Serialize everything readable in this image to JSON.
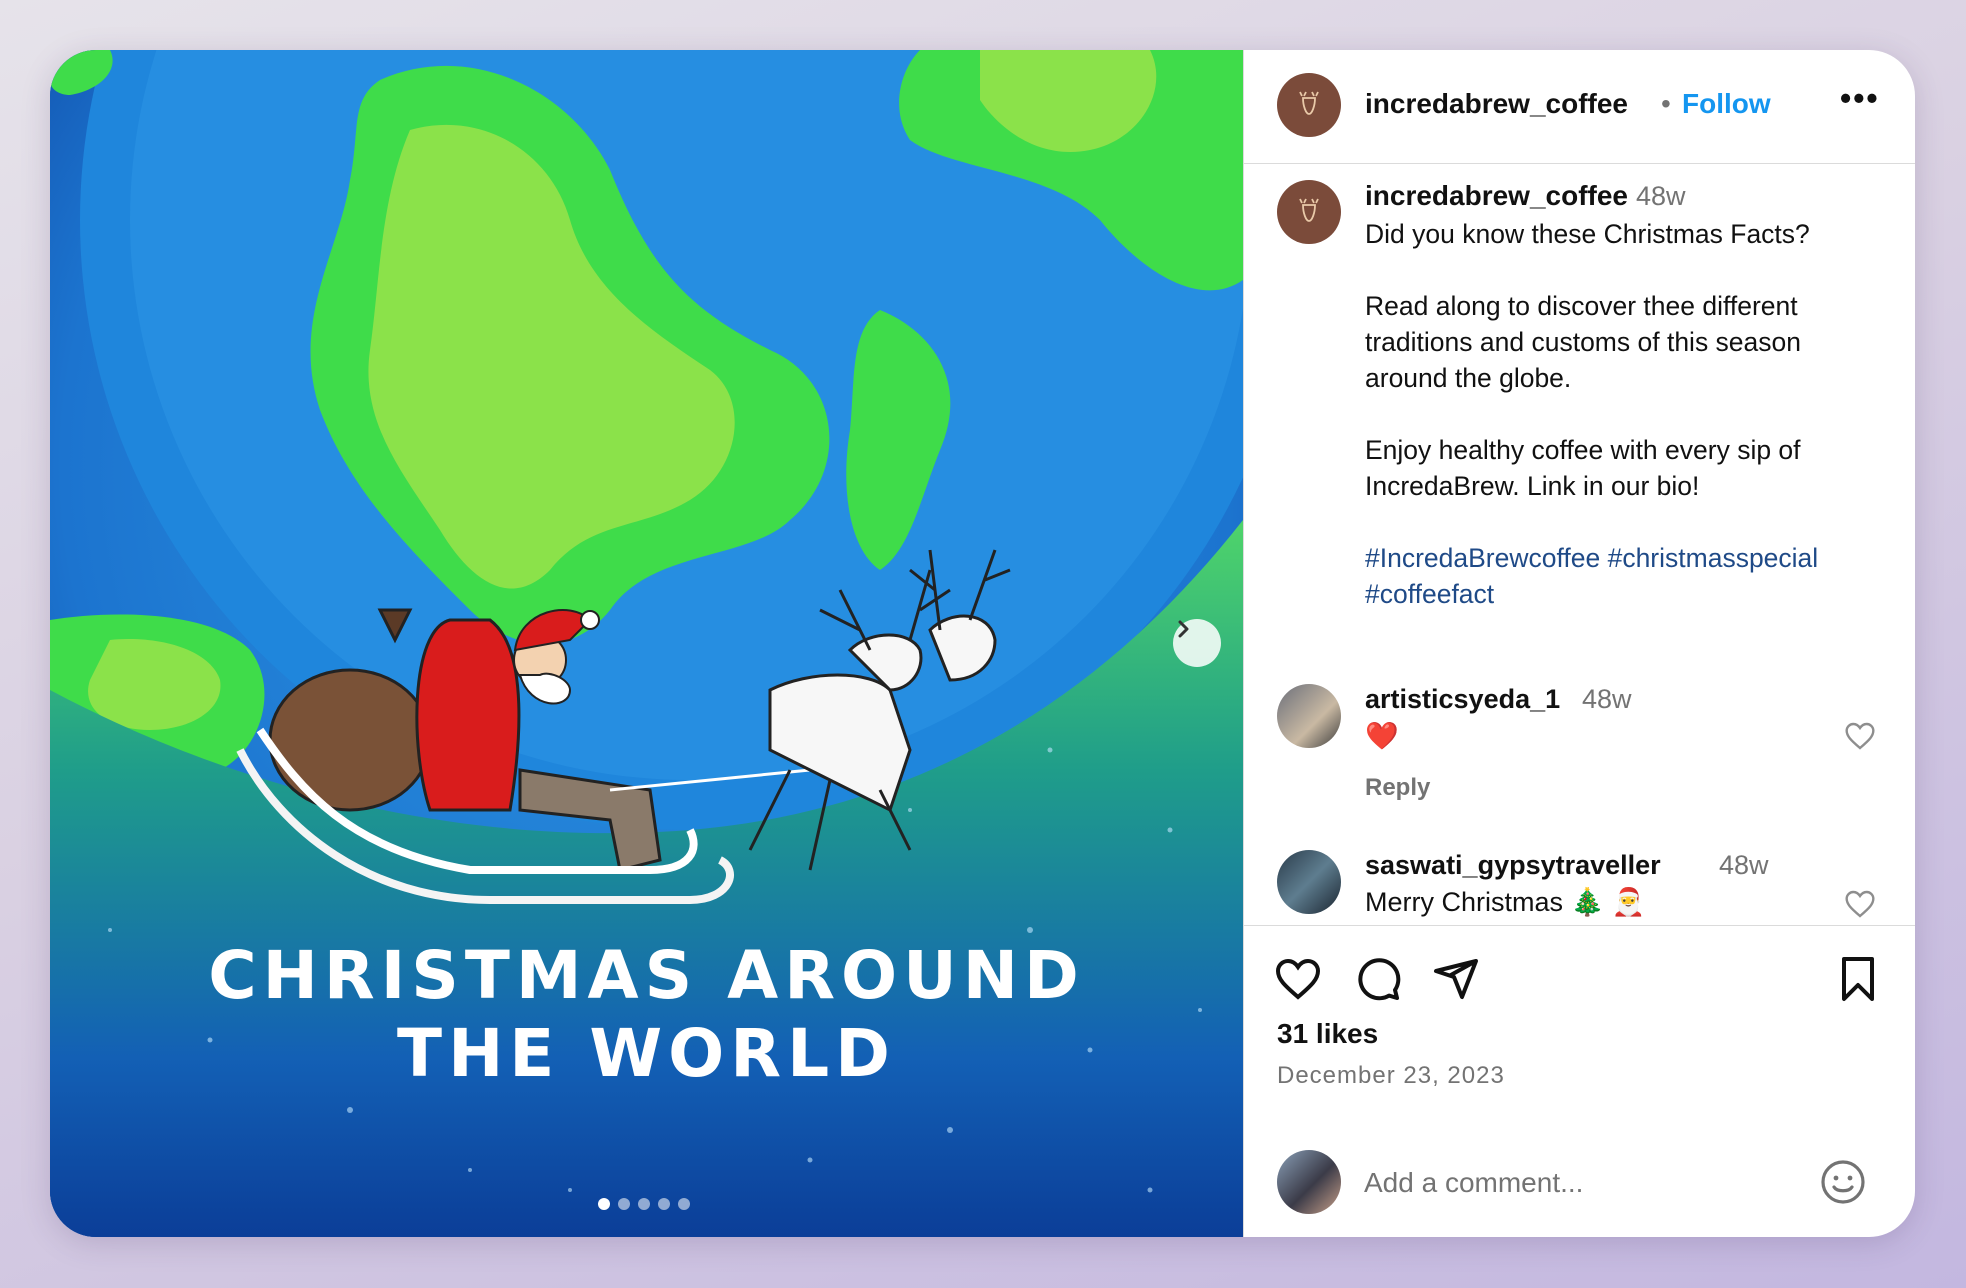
{
  "post": {
    "slide_title_line1": "CHRISTMAS AROUND",
    "slide_title_line2": "THE WORLD",
    "carousel_total": 5,
    "carousel_active": 1
  },
  "header": {
    "username": "incredabrew_coffee",
    "separator": "•",
    "follow_label": "Follow",
    "more_label": "•••"
  },
  "caption": {
    "username": "incredabrew_coffee",
    "time": "48w",
    "line1": "Did you know these Christmas Facts?",
    "para2": "Read along to discover thee different traditions and customs of this season around the globe.",
    "para3": "Enjoy healthy coffee with every sip of IncredaBrew. Link in our bio!",
    "hashtags": "#IncredaBrewcoffee #christmasspecial #coffeefact"
  },
  "comments": [
    {
      "username": "artisticsyeda_1",
      "time": "48w",
      "text": "❤️",
      "reply_label": "Reply"
    },
    {
      "username": "saswati_gypsytraveller",
      "time": "48w",
      "text": "Merry Christmas 🎄 🎅"
    }
  ],
  "stats": {
    "likes": "31 likes",
    "date": "December 23, 2023"
  },
  "add_comment": {
    "placeholder": "Add a comment..."
  },
  "colors": {
    "follow": "#1496f0",
    "avatar_bg": "#7b4b3a",
    "hashtag": "#1f4a87"
  }
}
